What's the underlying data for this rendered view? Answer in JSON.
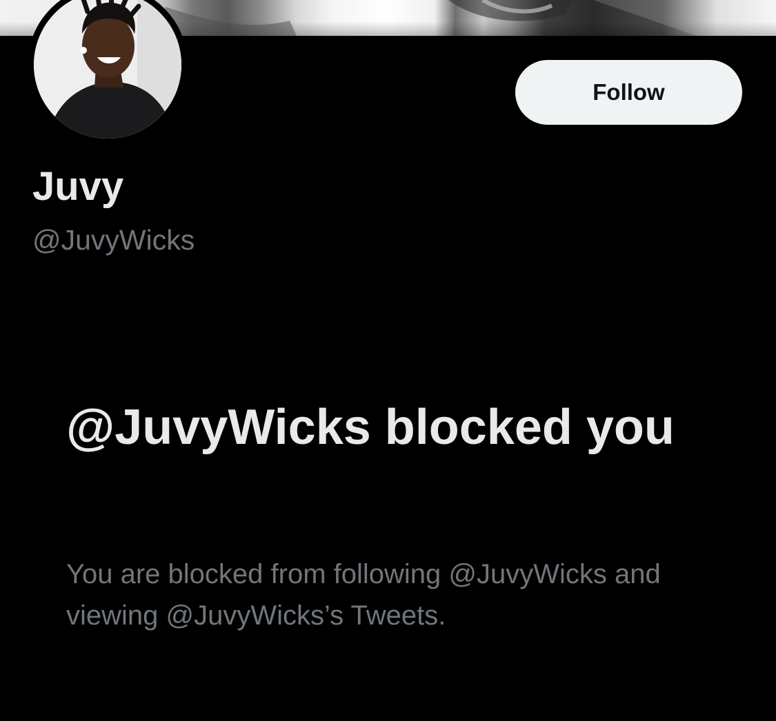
{
  "profile": {
    "display_name": "Juvy",
    "handle": "@JuvyWicks",
    "avatar_alt": "avatar"
  },
  "actions": {
    "follow_label": "Follow"
  },
  "blocked": {
    "title": "@JuvyWicks blocked you",
    "description": "You are blocked from following @JuvyWicks and viewing @JuvyWicks’s Tweets."
  },
  "colors": {
    "background": "#000000",
    "primary_text": "#e7e9ea",
    "secondary_text": "#71767b",
    "button_bg": "#eff3f4",
    "button_text": "#0f1419"
  }
}
